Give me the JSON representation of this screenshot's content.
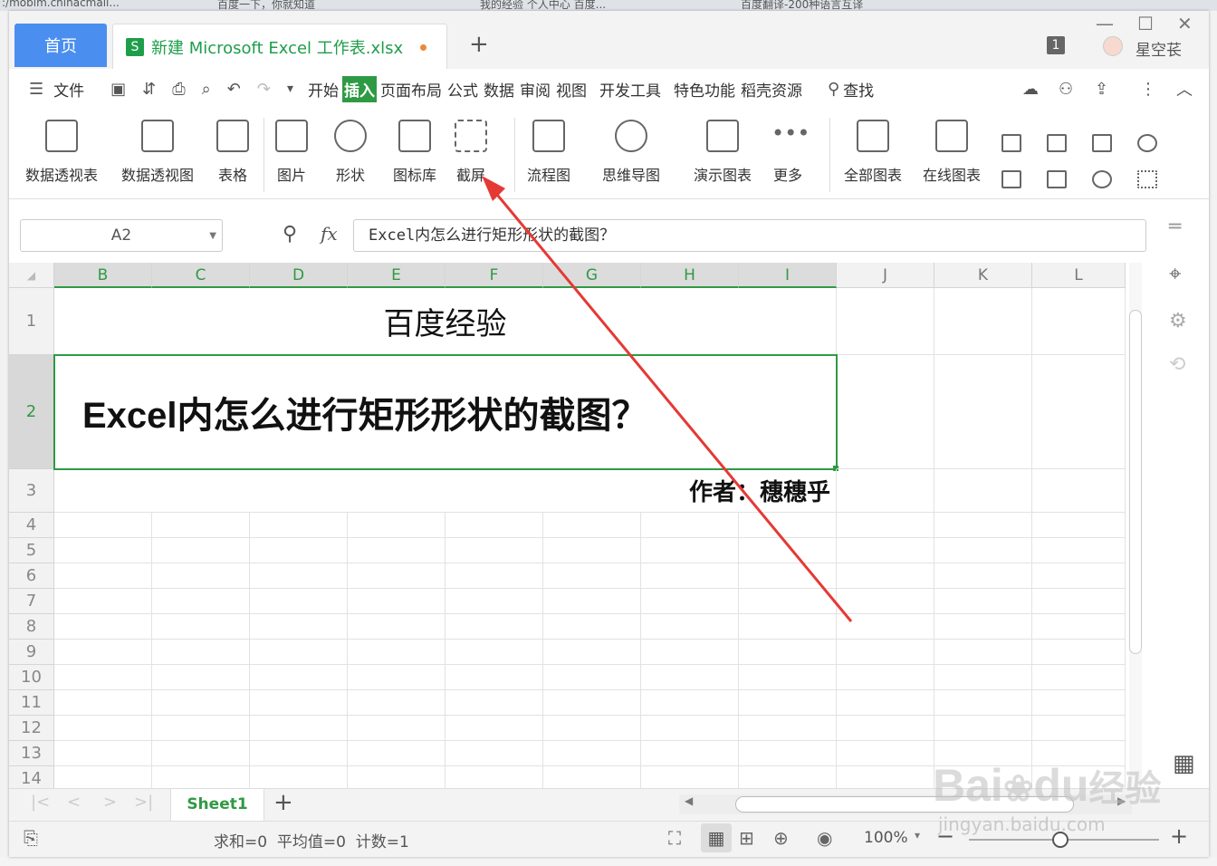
{
  "browser_tabs": [
    ":/mobim.chinacmail...",
    "百度一下，你就知道",
    "我的经验 个人中心 百度...",
    "百度翻译-200种语言互译"
  ],
  "app": {
    "home_tab": "首页",
    "file_tab": "新建 Microsoft Excel 工作表.xlsx",
    "new_tab": "+",
    "badge": "1",
    "user_name": "星空苌"
  },
  "menubar": {
    "file": "文件",
    "tabs": [
      "开始",
      "插入",
      "页面布局",
      "公式",
      "数据",
      "审阅",
      "视图",
      "开发工具",
      "特色功能",
      "稻壳资源"
    ],
    "active_tab": "插入",
    "search": "查找"
  },
  "ribbon": {
    "buttons": [
      "数据透视表",
      "数据透视图",
      "表格",
      "图片",
      "形状",
      "图标库",
      "截屏",
      "流程图",
      "思维导图",
      "演示图表",
      "更多",
      "全部图表",
      "在线图表"
    ]
  },
  "formula": {
    "namebox": "A2",
    "fx": "fx",
    "content": "Excel内怎么进行矩形形状的截图？"
  },
  "grid": {
    "columns": [
      "B",
      "C",
      "D",
      "E",
      "F",
      "G",
      "H",
      "I",
      "J",
      "K",
      "L"
    ],
    "selected_columns": [
      "B",
      "C",
      "D",
      "E",
      "F",
      "G",
      "H",
      "I"
    ],
    "rows": [
      "1",
      "2",
      "3",
      "4",
      "5",
      "6",
      "7",
      "8",
      "9",
      "10",
      "11",
      "12",
      "13",
      "14"
    ],
    "selected_row": "2",
    "cell_title": "百度经验",
    "cell_question": "Excel内怎么进行矩形形状的截图？",
    "cell_author": "作者：穗穗乎"
  },
  "sheetbar": {
    "sheet_name": "Sheet1",
    "add": "+"
  },
  "status": {
    "summary": "求和=0  平均值=0  计数=1",
    "zoom": "100%"
  },
  "watermark": {
    "brand": "Bai",
    "brand2": "du",
    "suffix": "经验",
    "url": "jingyan.baidu.com"
  },
  "colors": {
    "accent_green": "#2f9a44",
    "home_blue": "#4a8ef0",
    "arrow_red": "#e53935"
  }
}
